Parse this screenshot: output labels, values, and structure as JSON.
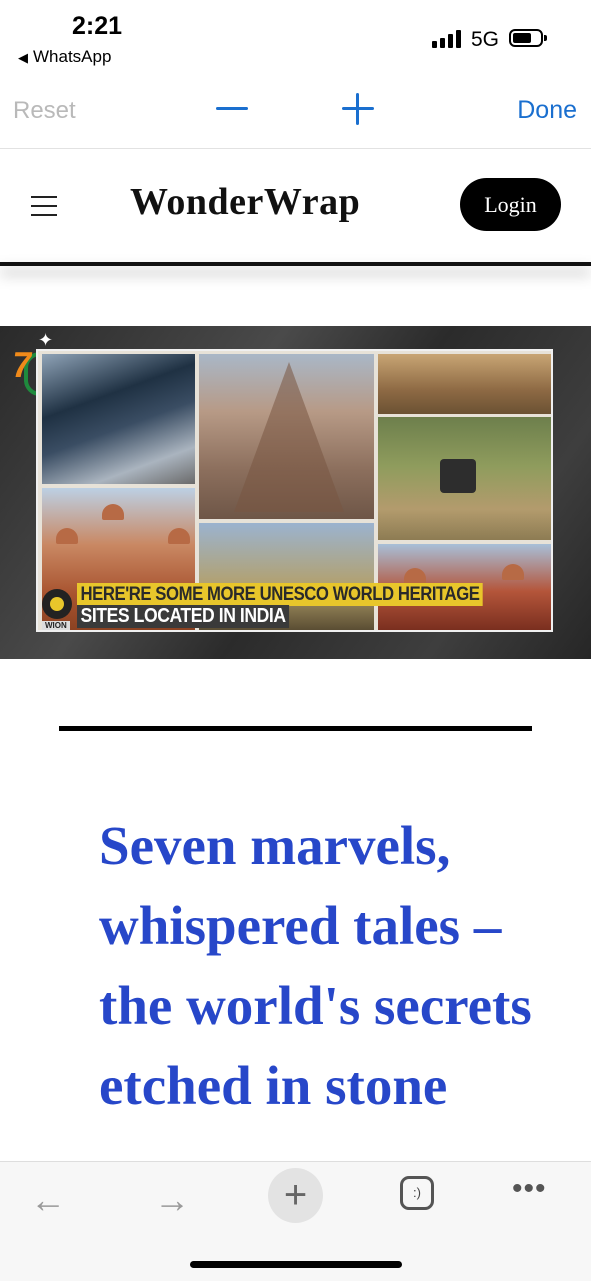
{
  "status_bar": {
    "time": "2:21",
    "back_app": "WhatsApp",
    "network": "5G"
  },
  "zoom_toolbar": {
    "reset_label": "Reset",
    "done_label": "Done"
  },
  "site_header": {
    "brand": "WonderWrap",
    "login_label": "Login"
  },
  "hero": {
    "caption_line1": "HERE'RE SOME MORE UNESCO WORLD HERITAGE",
    "caption_line2": "SITES LOCATED IN INDIA",
    "channel_logo_text": "WION"
  },
  "article": {
    "headline": "Seven marvels, whispered tales – the world's secrets etched in stone"
  },
  "bottom_toolbar": {
    "tabs_glyph": ":)"
  },
  "colors": {
    "accent_blue": "#1a6fcf",
    "headline_blue": "#2747c9",
    "caption_yellow": "#e8c62b"
  }
}
